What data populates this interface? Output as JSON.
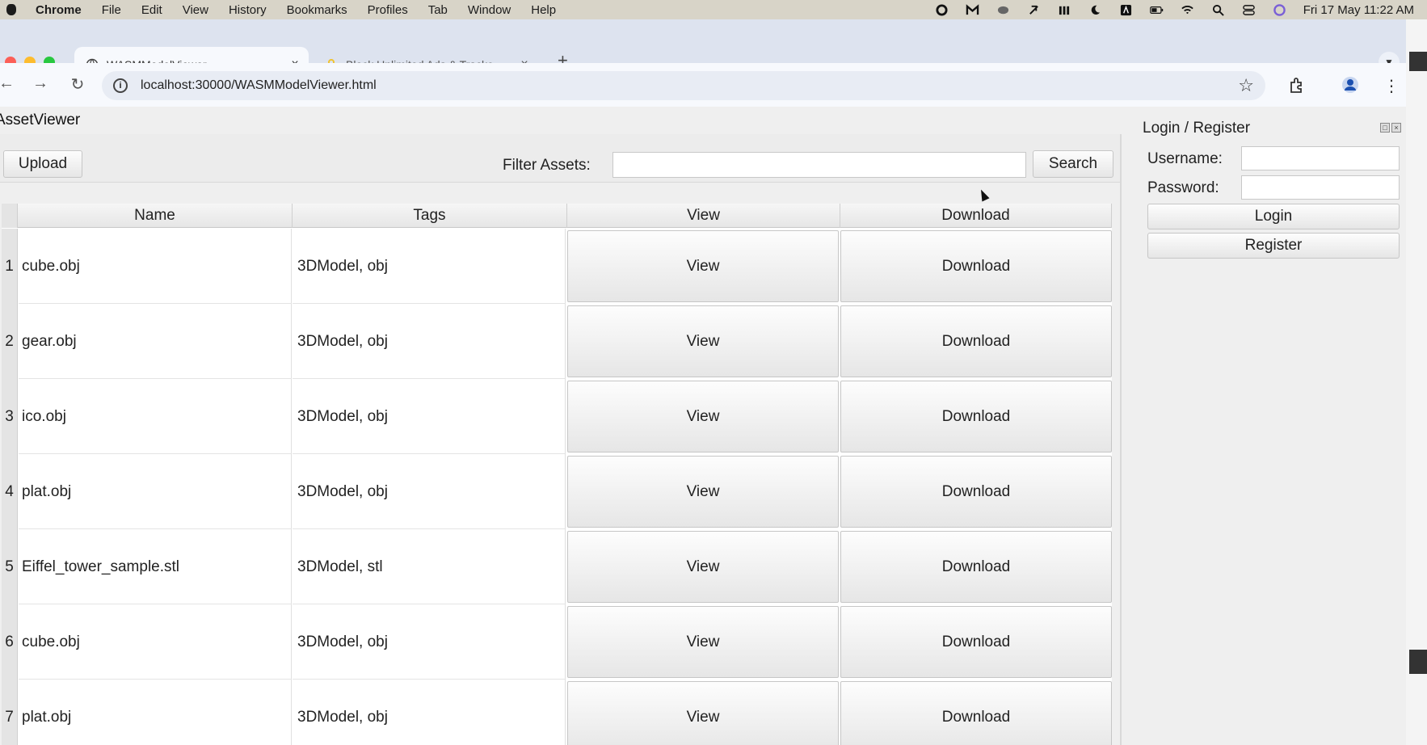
{
  "menubar": {
    "items": [
      "Chrome",
      "File",
      "Edit",
      "View",
      "History",
      "Bookmarks",
      "Profiles",
      "Tab",
      "Window",
      "Help"
    ],
    "clock": "Fri 17 May  11:22 AM"
  },
  "browser": {
    "tabs": [
      {
        "title": "WASMModelViewer",
        "close": "×"
      },
      {
        "title": "Block Unlimited Ads & Tracke",
        "close": "×"
      }
    ],
    "new_tab": "+",
    "url": "localhost:30000/WASMModelViewer.html"
  },
  "app": {
    "title": "AssetViewer",
    "upload_label": "Upload",
    "filter_label": "Filter Assets:",
    "filter_value": "",
    "search_label": "Search",
    "columns": [
      "Name",
      "Tags",
      "View",
      "Download"
    ],
    "rows": [
      {
        "num": "1",
        "name": "cube.obj",
        "tags": "3DModel, obj",
        "view": "View",
        "download": "Download"
      },
      {
        "num": "2",
        "name": "gear.obj",
        "tags": "3DModel, obj",
        "view": "View",
        "download": "Download"
      },
      {
        "num": "3",
        "name": "ico.obj",
        "tags": "3DModel, obj",
        "view": "View",
        "download": "Download"
      },
      {
        "num": "4",
        "name": "plat.obj",
        "tags": "3DModel, obj",
        "view": "View",
        "download": "Download"
      },
      {
        "num": "5",
        "name": "Eiffel_tower_sample.stl",
        "tags": "3DModel, stl",
        "view": "View",
        "download": "Download"
      },
      {
        "num": "6",
        "name": "cube.obj",
        "tags": "3DModel, obj",
        "view": "View",
        "download": "Download"
      },
      {
        "num": "7",
        "name": "plat.obj",
        "tags": "3DModel, obj",
        "view": "View",
        "download": "Download"
      }
    ]
  },
  "login": {
    "title": "Login / Register",
    "username_label": "Username:",
    "username_value": "",
    "password_label": "Password:",
    "password_value": "",
    "login_label": "Login",
    "register_label": "Register"
  }
}
